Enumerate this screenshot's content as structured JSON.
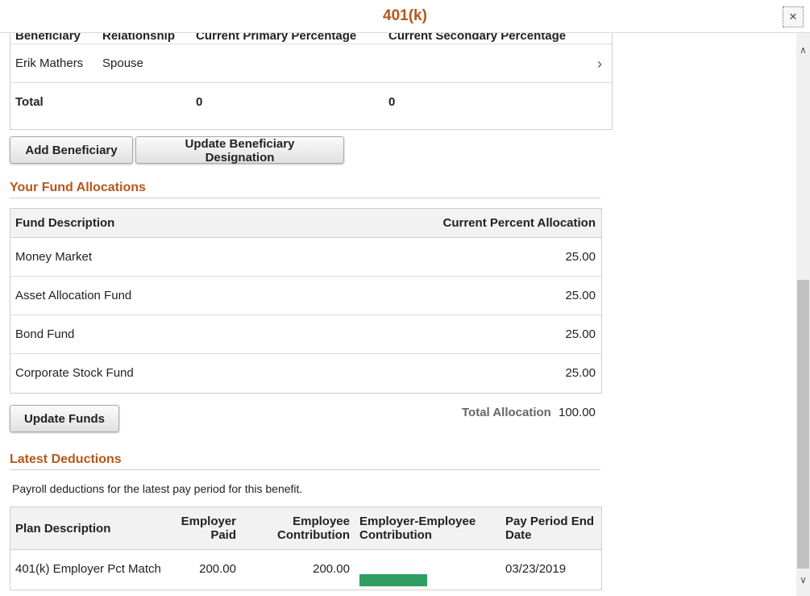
{
  "window": {
    "title": "401(k)",
    "close_label": "×"
  },
  "beneficiaries": {
    "headers": {
      "beneficiary": "Beneficiary",
      "relationship": "Relationship",
      "primary": "Current Primary Percentage",
      "secondary": "Current Secondary Percentage"
    },
    "row": {
      "name": "Erik Mathers",
      "relationship": "Spouse",
      "primary": "",
      "secondary": ""
    },
    "total": {
      "label": "Total",
      "primary": "0",
      "secondary": "0"
    }
  },
  "buttons": {
    "add_beneficiary": "Add Beneficiary",
    "update_designation": "Update Beneficiary Designation",
    "update_funds": "Update Funds"
  },
  "fund_allocations": {
    "title": "Your Fund Allocations",
    "headers": {
      "description": "Fund Description",
      "percent": "Current Percent Allocation"
    },
    "rows": [
      {
        "description": "Money Market",
        "percent": "25.00"
      },
      {
        "description": "Asset Allocation Fund",
        "percent": "25.00"
      },
      {
        "description": "Bond Fund",
        "percent": "25.00"
      },
      {
        "description": "Corporate Stock Fund",
        "percent": "25.00"
      }
    ],
    "total_label": "Total Allocation",
    "total_value": "100.00"
  },
  "deductions": {
    "title": "Latest Deductions",
    "note": "Payroll deductions for the latest pay period for this benefit.",
    "headers": {
      "plan": "Plan Description",
      "employer_paid_1": "Employer",
      "employer_paid_2": "Paid",
      "employee_contribution_1": "Employee",
      "employee_contribution_2": "Contribution",
      "combined_1": "Employer-Employee",
      "combined_2": "Contribution",
      "end_date_1": "Pay Period End",
      "end_date_2": "Date"
    },
    "row": {
      "plan": "401(k) Employer Pct Match",
      "employer_paid": "200.00",
      "employee_contribution": "200.00",
      "employer_share": 0.5,
      "end_date": "03/23/2019"
    },
    "colors": {
      "employer": "#d9593c",
      "employee": "#2e9e63"
    }
  },
  "colors": {
    "accent": "#b5561a"
  }
}
